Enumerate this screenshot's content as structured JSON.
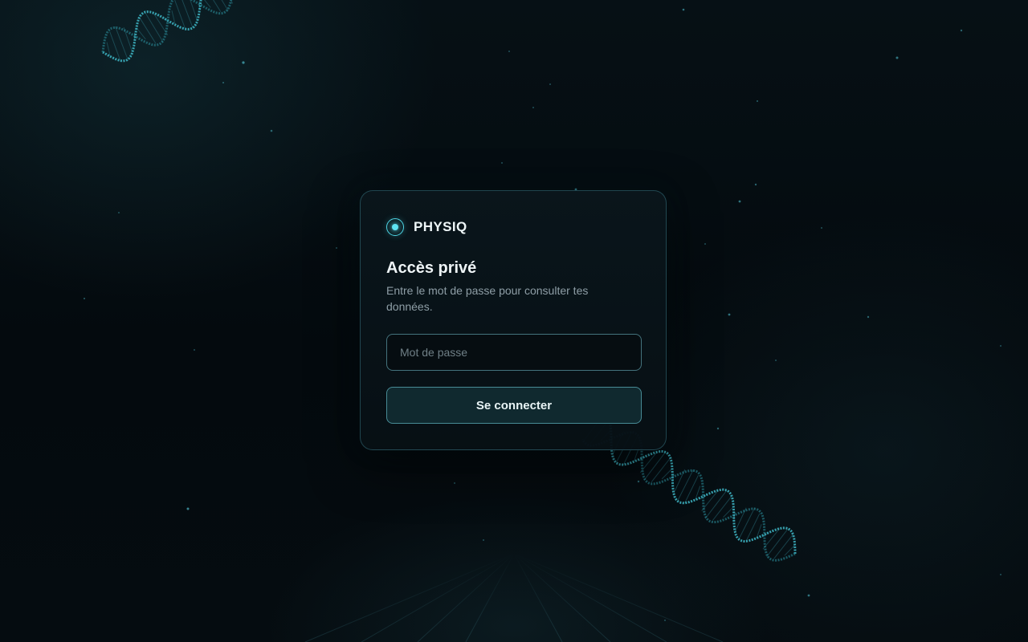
{
  "brand": {
    "name": "PHYSIQ",
    "icon": "radio-dot-icon",
    "accent_color": "#4fd6e6"
  },
  "login": {
    "title": "Accès privé",
    "subtitle": "Entre le mot de passe pour consulter tes données.",
    "password_placeholder": "Mot de passe",
    "password_value": "",
    "submit_label": "Se connecter"
  },
  "decorations": {
    "background_icons": [
      "dna-helix-icon",
      "dna-helix-icon"
    ],
    "background_color": "#050b0f"
  }
}
